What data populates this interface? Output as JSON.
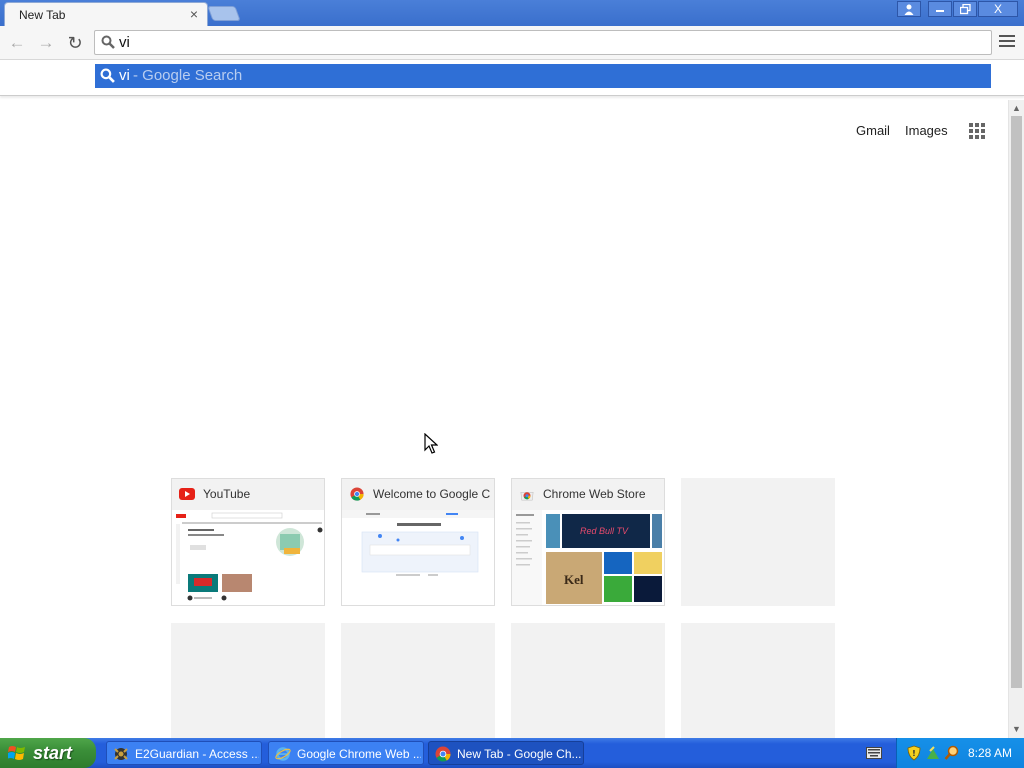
{
  "browser": {
    "tab_title": "New Tab",
    "tab_close": "×",
    "window_buttons": {
      "user": "👤",
      "minimize": "–",
      "maximize": "❐",
      "close": "X"
    }
  },
  "toolbar": {
    "back": "←",
    "forward": "→",
    "reload": "↻",
    "omnibox_value": "vi"
  },
  "suggestion": {
    "query": "vi",
    "description": "- Google Search"
  },
  "page": {
    "gmail": "Gmail",
    "images": "Images"
  },
  "tiles": [
    {
      "label": "YouTube",
      "favicon": "youtube-icon"
    },
    {
      "label": "Welcome to Google C",
      "favicon": "chrome-icon"
    },
    {
      "label": "Chrome Web Store",
      "favicon": "chrome-web-store-icon"
    }
  ],
  "taskbar": {
    "start": "start",
    "tasks": [
      {
        "label": "E2Guardian - Access ...",
        "icon": "e2guardian-icon"
      },
      {
        "label": "Google Chrome Web ...",
        "icon": "internet-explorer-icon"
      },
      {
        "label": "New Tab - Google Ch...",
        "icon": "chrome-icon"
      }
    ],
    "clock": "8:28 AM"
  },
  "colors": {
    "suggestion_highlight": "#2f6fd6",
    "taskbar": "#245edb",
    "start_button": "#3b8f39",
    "tray": "#0f84e0"
  }
}
